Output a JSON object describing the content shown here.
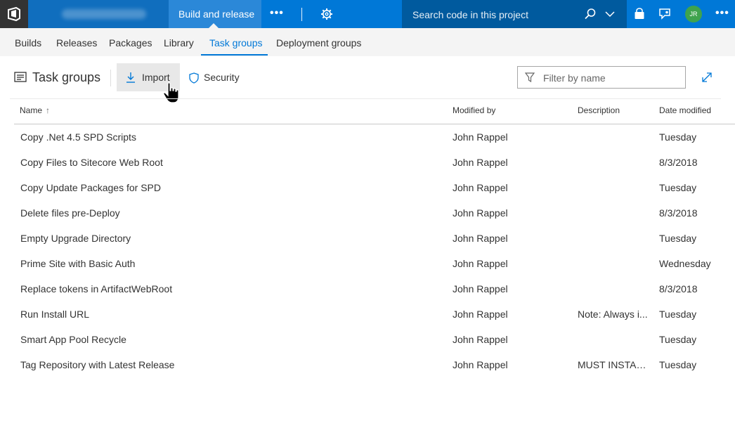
{
  "header": {
    "logo_icon": "azure-devops-logo",
    "project_name": "",
    "hub_label": "Build and release",
    "more_label": "•••",
    "settings_icon": "gear-icon",
    "search_placeholder": "Search code in this project",
    "avatar_initials": "JR",
    "right_more_label": "•••",
    "accent_color": "#0078d7",
    "avatar_color": "#3fa34d"
  },
  "subnav": {
    "tabs": [
      {
        "label": "Builds"
      },
      {
        "label": "Releases"
      },
      {
        "label": "Packages"
      },
      {
        "label": "Library"
      },
      {
        "label": "Task groups",
        "active": true
      },
      {
        "label": "Deployment groups"
      }
    ]
  },
  "toolbar": {
    "title": "Task groups",
    "import_label": "Import",
    "security_label": "Security",
    "filter_placeholder": "Filter by name"
  },
  "table": {
    "columns": {
      "name": "Name",
      "modified_by": "Modified by",
      "description": "Description",
      "date_modified": "Date modified"
    },
    "sort_indicator": "↑",
    "rows": [
      {
        "name": "Copy .Net 4.5 SPD Scripts",
        "modified_by": "John Rappel",
        "description": "",
        "date": "Tuesday"
      },
      {
        "name": "Copy Files to Sitecore Web Root",
        "modified_by": "John Rappel",
        "description": "",
        "date": "8/3/2018"
      },
      {
        "name": "Copy Update Packages for SPD",
        "modified_by": "John Rappel",
        "description": "",
        "date": "Tuesday"
      },
      {
        "name": "Delete files pre-Deploy",
        "modified_by": "John Rappel",
        "description": "",
        "date": "8/3/2018"
      },
      {
        "name": "Empty Upgrade Directory",
        "modified_by": "John Rappel",
        "description": "",
        "date": "Tuesday"
      },
      {
        "name": "Prime Site with Basic Auth",
        "modified_by": "John Rappel",
        "description": "",
        "date": "Wednesday"
      },
      {
        "name": "Replace tokens in ArtifactWebRoot",
        "modified_by": "John Rappel",
        "description": "",
        "date": "8/3/2018"
      },
      {
        "name": "Run Install URL",
        "modified_by": "John Rappel",
        "description": "Note: Always i...",
        "date": "Tuesday"
      },
      {
        "name": "Smart App Pool Recycle",
        "modified_by": "John Rappel",
        "description": "",
        "date": "Tuesday"
      },
      {
        "name": "Tag Repository with Latest Release",
        "modified_by": "John Rappel",
        "description": "MUST INSTAL...",
        "date": "Tuesday"
      }
    ]
  }
}
